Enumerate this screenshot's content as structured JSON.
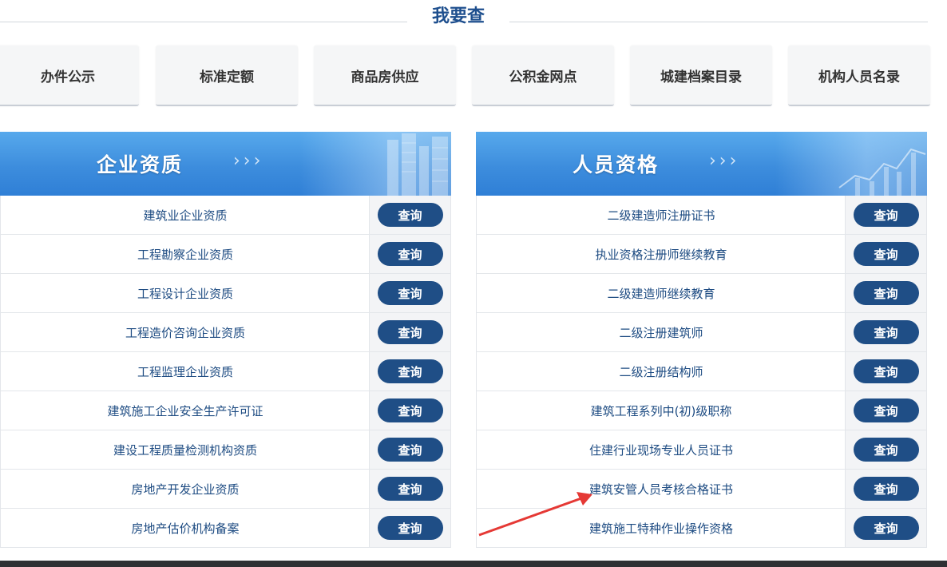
{
  "heading": {
    "title": "我要查"
  },
  "quick_links": [
    "办件公示",
    "标准定额",
    "商品房供应",
    "公积金网点",
    "城建档案目录",
    "机构人员名录"
  ],
  "left_panel": {
    "title": "企业资质",
    "arrows": "›››",
    "items": [
      {
        "name": "建筑业企业资质",
        "action": "查询"
      },
      {
        "name": "工程勘察企业资质",
        "action": "查询"
      },
      {
        "name": "工程设计企业资质",
        "action": "查询"
      },
      {
        "name": "工程造价咨询企业资质",
        "action": "查询"
      },
      {
        "name": "工程监理企业资质",
        "action": "查询"
      },
      {
        "name": "建筑施工企业安全生产许可证",
        "action": "查询"
      },
      {
        "name": "建设工程质量检测机构资质",
        "action": "查询"
      },
      {
        "name": "房地产开发企业资质",
        "action": "查询"
      },
      {
        "name": "房地产估价机构备案",
        "action": "查询"
      }
    ]
  },
  "right_panel": {
    "title": "人员资格",
    "arrows": "›››",
    "items": [
      {
        "name": "二级建造师注册证书",
        "action": "查询"
      },
      {
        "name": "执业资格注册师继续教育",
        "action": "查询"
      },
      {
        "name": "二级建造师继续教育",
        "action": "查询"
      },
      {
        "name": "二级注册建筑师",
        "action": "查询"
      },
      {
        "name": "二级注册结构师",
        "action": "查询"
      },
      {
        "name": "建筑工程系列中(初)级职称",
        "action": "查询"
      },
      {
        "name": "住建行业现场专业人员证书",
        "action": "查询"
      },
      {
        "name": "建筑安管人员考核合格证书",
        "action": "查询"
      },
      {
        "name": "建筑施工特种作业操作资格",
        "action": "查询"
      }
    ]
  },
  "colors": {
    "title": "#1e4f8e",
    "button": "#1f4e86",
    "link_text": "#1d4b82",
    "banner": "#3d8ddd",
    "annotation_arrow": "#e53935"
  },
  "icons": [
    "banner-decoration-left",
    "banner-decoration-right",
    "red-annotation-arrow"
  ]
}
